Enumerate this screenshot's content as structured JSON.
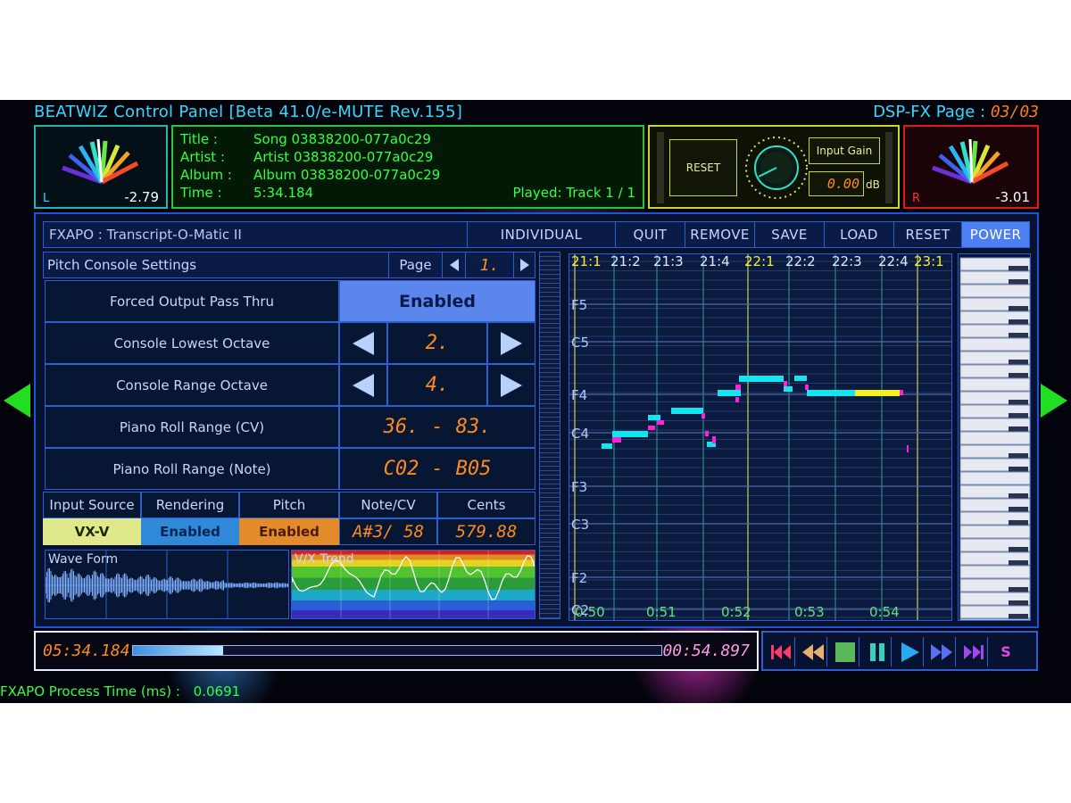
{
  "app": {
    "title": "BEATWIZ Control Panel [Beta 41.0/e-MUTE Rev.155]"
  },
  "dsp_page": {
    "label": "DSP-FX Page :",
    "value": "03/03"
  },
  "meters": {
    "left": {
      "channel": "L",
      "value": "-2.79"
    },
    "right": {
      "channel": "R",
      "value": "-3.01"
    }
  },
  "track_info": {
    "title_label": "Title :",
    "title": "Song 03838200-077a0c29",
    "artist_label": "Artist :",
    "artist": "Artist 03838200-077a0c29",
    "album_label": "Album :",
    "album": "Album 03838200-077a0c29",
    "time_label": "Time :",
    "time": "5:34.184",
    "played": "Played: Track 1 / 1"
  },
  "gain": {
    "reset_label": "RESET",
    "input_gain_label": "Input Gain",
    "value": "0.00",
    "unit": "dB"
  },
  "plugin": {
    "name": "FXAPO : Transcript-O-Matic II",
    "buttons": [
      "INDIVIDUAL",
      "QUIT",
      "REMOVE",
      "SAVE",
      "LOAD",
      "RESET",
      "POWER"
    ]
  },
  "console": {
    "title": "Pitch Console Settings",
    "page_label": "Page",
    "page_value": "1.",
    "rows": [
      {
        "label": "Forced Output Pass Thru",
        "value": "Enabled"
      },
      {
        "label": "Console Lowest Octave",
        "value": "2."
      },
      {
        "label": "Console Range Octave",
        "value": "4."
      },
      {
        "label": "Piano Roll Range (CV)",
        "value_a": "36.",
        "sep": "-",
        "value_b": "83."
      },
      {
        "label": "Piano Roll Range (Note)",
        "value_a": "C02",
        "sep": "-",
        "value_b": "B05"
      }
    ]
  },
  "status_row": {
    "headers": [
      "Input Source",
      "Rendering",
      "Pitch",
      "Note/CV",
      "Cents"
    ],
    "values": {
      "input_source": "VX-V",
      "rendering": "Enabled",
      "pitch": "Enabled",
      "note_cv": "A#3/ 58",
      "cents": "579.88"
    }
  },
  "waveform": {
    "label": "Wave Form"
  },
  "trend": {
    "label": "V/X Trend"
  },
  "piano_roll": {
    "bars": [
      "21:1",
      "21:2",
      "21:3",
      "21:4",
      "22:1",
      "22:2",
      "22:3",
      "22:4",
      "23:1"
    ],
    "notes": [
      "F5",
      "C5",
      "F4",
      "C4",
      "F3",
      "C3",
      "F2",
      "C2"
    ],
    "times": [
      "0:50",
      "0:51",
      "0:52",
      "0:53",
      "0:54"
    ]
  },
  "transport": {
    "current_time": "05:34.184",
    "remaining_time": "00:54.897",
    "progress": 0.17,
    "stop_key_label": "S"
  },
  "status": {
    "label": "FXAPO Process Time (ms) :",
    "value": "0.0691"
  },
  "colors": {
    "cyan": "#33d9ff",
    "green": "#33ff44",
    "accent": "#4e7ff0",
    "orange": "#ff8a1c",
    "note_cyan": "#10e8f0",
    "note_magenta": "#ff22dd",
    "note_yellow": "#f5f020"
  }
}
